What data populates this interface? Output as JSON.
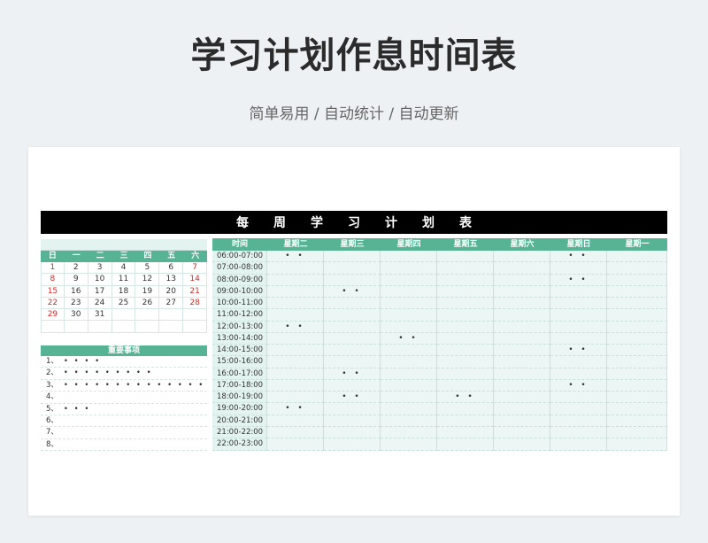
{
  "header": {
    "title": "学习计划作息时间表",
    "subtitle": "简单易用 / 自动统计 / 自动更新"
  },
  "banner": [
    "每",
    "周",
    "学",
    "习",
    "计",
    "划",
    "表"
  ],
  "calendar": {
    "weekdays": [
      "日",
      "一",
      "二",
      "三",
      "四",
      "五",
      "六"
    ],
    "weeks": [
      [
        "1",
        "2",
        "3",
        "4",
        "5",
        "6",
        "7"
      ],
      [
        "8",
        "9",
        "10",
        "11",
        "12",
        "13",
        "14"
      ],
      [
        "15",
        "16",
        "17",
        "18",
        "19",
        "20",
        "21"
      ],
      [
        "22",
        "23",
        "24",
        "25",
        "26",
        "27",
        "28"
      ],
      [
        "29",
        "30",
        "31",
        "",
        "",
        "",
        ""
      ],
      [
        "",
        "",
        "",
        "",
        "",
        "",
        ""
      ]
    ],
    "weekend_color": "#d32b2b"
  },
  "important": {
    "title": "重要事项",
    "items": [
      {
        "num": "1、",
        "text": "• • • •"
      },
      {
        "num": "2、",
        "text": "• • • • • • • • •"
      },
      {
        "num": "3、",
        "text": "• • • • • • • • • • • • • • •"
      },
      {
        "num": "4、",
        "text": ""
      },
      {
        "num": "5、",
        "text": "• • •"
      },
      {
        "num": "6、",
        "text": ""
      },
      {
        "num": "7、",
        "text": ""
      },
      {
        "num": "8、",
        "text": ""
      }
    ]
  },
  "schedule": {
    "headers": [
      "时间",
      "星期二",
      "星期三",
      "星期四",
      "星期五",
      "星期六",
      "星期日",
      "星期一"
    ],
    "rows": [
      [
        "06:00-07:00",
        "• •",
        "",
        "",
        "",
        "",
        "• •",
        ""
      ],
      [
        "07:00-08:00",
        "",
        "",
        "",
        "",
        "",
        "",
        ""
      ],
      [
        "08:00-09:00",
        "",
        "",
        "",
        "",
        "",
        "• •",
        ""
      ],
      [
        "09:00-10:00",
        "",
        "• •",
        "",
        "",
        "",
        "",
        ""
      ],
      [
        "10:00-11:00",
        "",
        "",
        "",
        "",
        "",
        "",
        ""
      ],
      [
        "11:00-12:00",
        "",
        "",
        "",
        "",
        "",
        "",
        ""
      ],
      [
        "12:00-13:00",
        "• •",
        "",
        "",
        "",
        "",
        "",
        ""
      ],
      [
        "13:00-14:00",
        "",
        "",
        "• •",
        "",
        "",
        "",
        ""
      ],
      [
        "14:00-15:00",
        "",
        "",
        "",
        "",
        "",
        "• •",
        ""
      ],
      [
        "15:00-16:00",
        "",
        "",
        "",
        "",
        "",
        "",
        ""
      ],
      [
        "16:00-17:00",
        "",
        "• •",
        "",
        "",
        "",
        "",
        ""
      ],
      [
        "17:00-18:00",
        "",
        "",
        "",
        "",
        "",
        "• •",
        ""
      ],
      [
        "18:00-19:00",
        "",
        "• •",
        "",
        "• •",
        "",
        "",
        ""
      ],
      [
        "19:00-20:00",
        "• •",
        "",
        "",
        "",
        "",
        "",
        ""
      ],
      [
        "20:00-21:00",
        "",
        "",
        "",
        "",
        "",
        "",
        ""
      ],
      [
        "21:00-22:00",
        "",
        "",
        "",
        "",
        "",
        "",
        ""
      ],
      [
        "22:00-23:00",
        "",
        "",
        "",
        "",
        "",
        "",
        ""
      ]
    ]
  },
  "colors": {
    "accent": "#56b394",
    "banner": "#000000",
    "cell": "#ecf7f5"
  }
}
